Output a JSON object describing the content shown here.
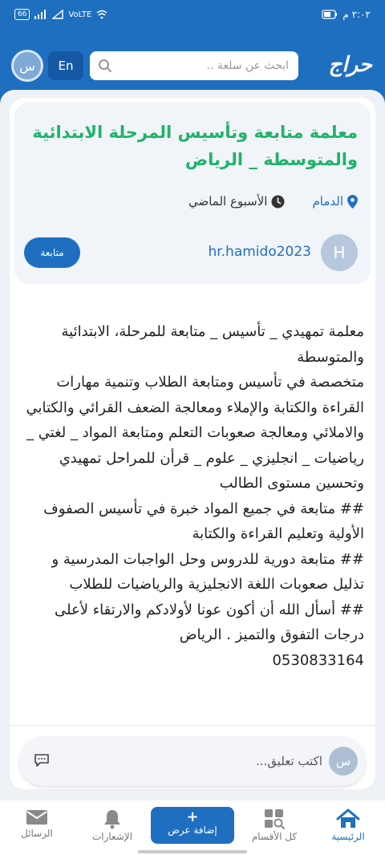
{
  "status_bar": {
    "time": "٢:٠٢ م",
    "left_icons": [
      "battery-icon",
      "signal-icon",
      "volte-icon",
      "wifi-icon"
    ],
    "volte": "VoLTE",
    "battery_box": "66"
  },
  "header": {
    "logo": "حراج",
    "search_placeholder": "ابحث عن سلعة ..",
    "lang_button": "En",
    "avatar_initial": "س"
  },
  "ad": {
    "title": "معلمة متابعة وتأسيس المرحلة الابتدائية والمتوسطة _ الرياض",
    "location": "الدمام",
    "time_posted": "الأسبوع الماضي",
    "user_initial": "H",
    "username": "hr.hamido2023",
    "follow_label": "متابعة",
    "body": "معلمة تمهيدي _ تأسيس _ متابعة للمرحلة، الابتدائية والمتوسطة\nمتخصصة في تأسيس ومتابعة الطلاب وتنمية مهارات القراءة والكتابة والإملاء ومعالجة الضعف القرائي والكتابي والاملائي ومعالجة صعوبات التعلم ومتابعة المواد _ لغتي _ رياضيات _ انجليزي _ علوم _ قرأن للمراحل تمهيدي وتحسين مستوى الطالب\n## متابعة في جميع المواد خبرة في تأسيس الصفوف الأولية وتعليم القراءة والكتابة\n## متابعة دورية للدروس وحل الواجبات المدرسية و تذليل صعوبات اللغة الانجليزية والرياضيات للطلاب\n## أسأل الله أن أكون عونا لأولادكم والارتقاء لأعلى درجات التفوق والتميز . الرياض\n0530833164"
  },
  "comment": {
    "avatar_initial": "س",
    "placeholder": "اكتب تعليق..."
  },
  "bottom_nav": {
    "home": "الرئيسية",
    "categories": "كل الأقسام",
    "add_offer": "إضافة عرض",
    "add_plus": "+",
    "notifications": "الإشعارات",
    "messages": "الرسائل",
    "active_color": "#1f6fc0"
  }
}
